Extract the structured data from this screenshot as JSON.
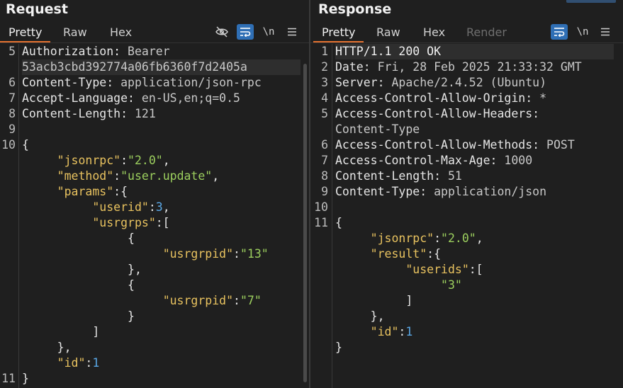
{
  "request": {
    "title": "Request",
    "tabs": [
      "Pretty",
      "Raw",
      "Hex"
    ],
    "active_tab": "Pretty",
    "newline_label": "\\n",
    "lines": [
      {
        "n": "5",
        "parts": [
          [
            "k",
            "Authorization"
          ],
          [
            "p",
            ": "
          ],
          [
            "v",
            "Bearer"
          ]
        ]
      },
      {
        "n": "",
        "parts": [
          [
            "v",
            "53acb3cbd392774a06fb6360f7d2405a"
          ]
        ]
      },
      {
        "n": "6",
        "parts": [
          [
            "k",
            "Content-Type"
          ],
          [
            "p",
            ": "
          ],
          [
            "v",
            "application/json-rpc"
          ]
        ]
      },
      {
        "n": "7",
        "parts": [
          [
            "k",
            "Accept-Language"
          ],
          [
            "p",
            ": "
          ],
          [
            "v",
            "en-US,en;q=0.5"
          ]
        ]
      },
      {
        "n": "8",
        "parts": [
          [
            "k",
            "Content-Length"
          ],
          [
            "p",
            ": "
          ],
          [
            "v",
            "121"
          ]
        ]
      },
      {
        "n": "9",
        "parts": []
      },
      {
        "n": "10",
        "parts": [
          [
            "p",
            "{"
          ]
        ]
      },
      {
        "n": "",
        "parts": [
          [
            "p",
            "     "
          ],
          [
            "jk",
            "\"jsonrpc\""
          ],
          [
            "p",
            ":"
          ],
          [
            "js",
            "\"2.0\""
          ],
          [
            "p",
            ","
          ]
        ]
      },
      {
        "n": "",
        "parts": [
          [
            "p",
            "     "
          ],
          [
            "jk",
            "\"method\""
          ],
          [
            "p",
            ":"
          ],
          [
            "js",
            "\"user.update\""
          ],
          [
            "p",
            ","
          ]
        ]
      },
      {
        "n": "",
        "parts": [
          [
            "p",
            "     "
          ],
          [
            "jk",
            "\"params\""
          ],
          [
            "p",
            ":{"
          ]
        ]
      },
      {
        "n": "",
        "parts": [
          [
            "p",
            "          "
          ],
          [
            "jk",
            "\"userid\""
          ],
          [
            "p",
            ":"
          ],
          [
            "jn",
            "3"
          ],
          [
            "p",
            ","
          ]
        ]
      },
      {
        "n": "",
        "parts": [
          [
            "p",
            "          "
          ],
          [
            "jk",
            "\"usrgrps\""
          ],
          [
            "p",
            ":["
          ]
        ]
      },
      {
        "n": "",
        "parts": [
          [
            "p",
            "               {"
          ]
        ]
      },
      {
        "n": "",
        "parts": [
          [
            "p",
            "                    "
          ],
          [
            "jk",
            "\"usrgrpid\""
          ],
          [
            "p",
            ":"
          ],
          [
            "js",
            "\"13\""
          ]
        ]
      },
      {
        "n": "",
        "parts": [
          [
            "p",
            "               },"
          ]
        ]
      },
      {
        "n": "",
        "parts": [
          [
            "p",
            "               {"
          ]
        ]
      },
      {
        "n": "",
        "parts": [
          [
            "p",
            "                    "
          ],
          [
            "jk",
            "\"usrgrpid\""
          ],
          [
            "p",
            ":"
          ],
          [
            "js",
            "\"7\""
          ]
        ]
      },
      {
        "n": "",
        "parts": [
          [
            "p",
            "               }"
          ]
        ]
      },
      {
        "n": "",
        "parts": [
          [
            "p",
            "          ]"
          ]
        ]
      },
      {
        "n": "",
        "parts": [
          [
            "p",
            "     },"
          ]
        ]
      },
      {
        "n": "",
        "parts": [
          [
            "p",
            "     "
          ],
          [
            "jk",
            "\"id\""
          ],
          [
            "p",
            ":"
          ],
          [
            "jn",
            "1"
          ]
        ]
      },
      {
        "n": "11",
        "parts": [
          [
            "p",
            "}"
          ]
        ]
      }
    ]
  },
  "response": {
    "title": "Response",
    "tabs": [
      "Pretty",
      "Raw",
      "Hex",
      "Render"
    ],
    "active_tab": "Pretty",
    "newline_label": "\\n",
    "lines": [
      {
        "n": "1",
        "parts": [
          [
            "hdr",
            "HTTP/1.1 200 OK"
          ]
        ]
      },
      {
        "n": "2",
        "parts": [
          [
            "k",
            "Date"
          ],
          [
            "p",
            ": "
          ],
          [
            "v",
            "Fri, 28 Feb 2025 21:33:32 GMT"
          ]
        ]
      },
      {
        "n": "3",
        "parts": [
          [
            "k",
            "Server"
          ],
          [
            "p",
            ": "
          ],
          [
            "v",
            "Apache/2.4.52 (Ubuntu)"
          ]
        ]
      },
      {
        "n": "4",
        "parts": [
          [
            "k",
            "Access-Control-Allow-Origin"
          ],
          [
            "p",
            ": "
          ],
          [
            "v",
            "*"
          ]
        ]
      },
      {
        "n": "5",
        "parts": [
          [
            "k",
            "Access-Control-Allow-Headers"
          ],
          [
            "p",
            ":"
          ]
        ]
      },
      {
        "n": "",
        "parts": [
          [
            "v",
            "Content-Type"
          ]
        ]
      },
      {
        "n": "6",
        "parts": [
          [
            "k",
            "Access-Control-Allow-Methods"
          ],
          [
            "p",
            ": "
          ],
          [
            "v",
            "POST"
          ]
        ]
      },
      {
        "n": "7",
        "parts": [
          [
            "k",
            "Access-Control-Max-Age"
          ],
          [
            "p",
            ": "
          ],
          [
            "v",
            "1000"
          ]
        ]
      },
      {
        "n": "8",
        "parts": [
          [
            "k",
            "Content-Length"
          ],
          [
            "p",
            ": "
          ],
          [
            "v",
            "51"
          ]
        ]
      },
      {
        "n": "9",
        "parts": [
          [
            "k",
            "Content-Type"
          ],
          [
            "p",
            ": "
          ],
          [
            "v",
            "application/json"
          ]
        ]
      },
      {
        "n": "10",
        "parts": []
      },
      {
        "n": "11",
        "parts": [
          [
            "p",
            "{"
          ]
        ]
      },
      {
        "n": "",
        "parts": [
          [
            "p",
            "     "
          ],
          [
            "jk",
            "\"jsonrpc\""
          ],
          [
            "p",
            ":"
          ],
          [
            "js",
            "\"2.0\""
          ],
          [
            "p",
            ","
          ]
        ]
      },
      {
        "n": "",
        "parts": [
          [
            "p",
            "     "
          ],
          [
            "jk",
            "\"result\""
          ],
          [
            "p",
            ":{"
          ]
        ]
      },
      {
        "n": "",
        "parts": [
          [
            "p",
            "          "
          ],
          [
            "jk",
            "\"userids\""
          ],
          [
            "p",
            ":["
          ]
        ]
      },
      {
        "n": "",
        "parts": [
          [
            "p",
            "               "
          ],
          [
            "js",
            "\"3\""
          ]
        ]
      },
      {
        "n": "",
        "parts": [
          [
            "p",
            "          ]"
          ]
        ]
      },
      {
        "n": "",
        "parts": [
          [
            "p",
            "     },"
          ]
        ]
      },
      {
        "n": "",
        "parts": [
          [
            "p",
            "     "
          ],
          [
            "jk",
            "\"id\""
          ],
          [
            "p",
            ":"
          ],
          [
            "jn",
            "1"
          ]
        ]
      },
      {
        "n": "",
        "parts": [
          [
            "p",
            "}"
          ]
        ]
      }
    ]
  }
}
